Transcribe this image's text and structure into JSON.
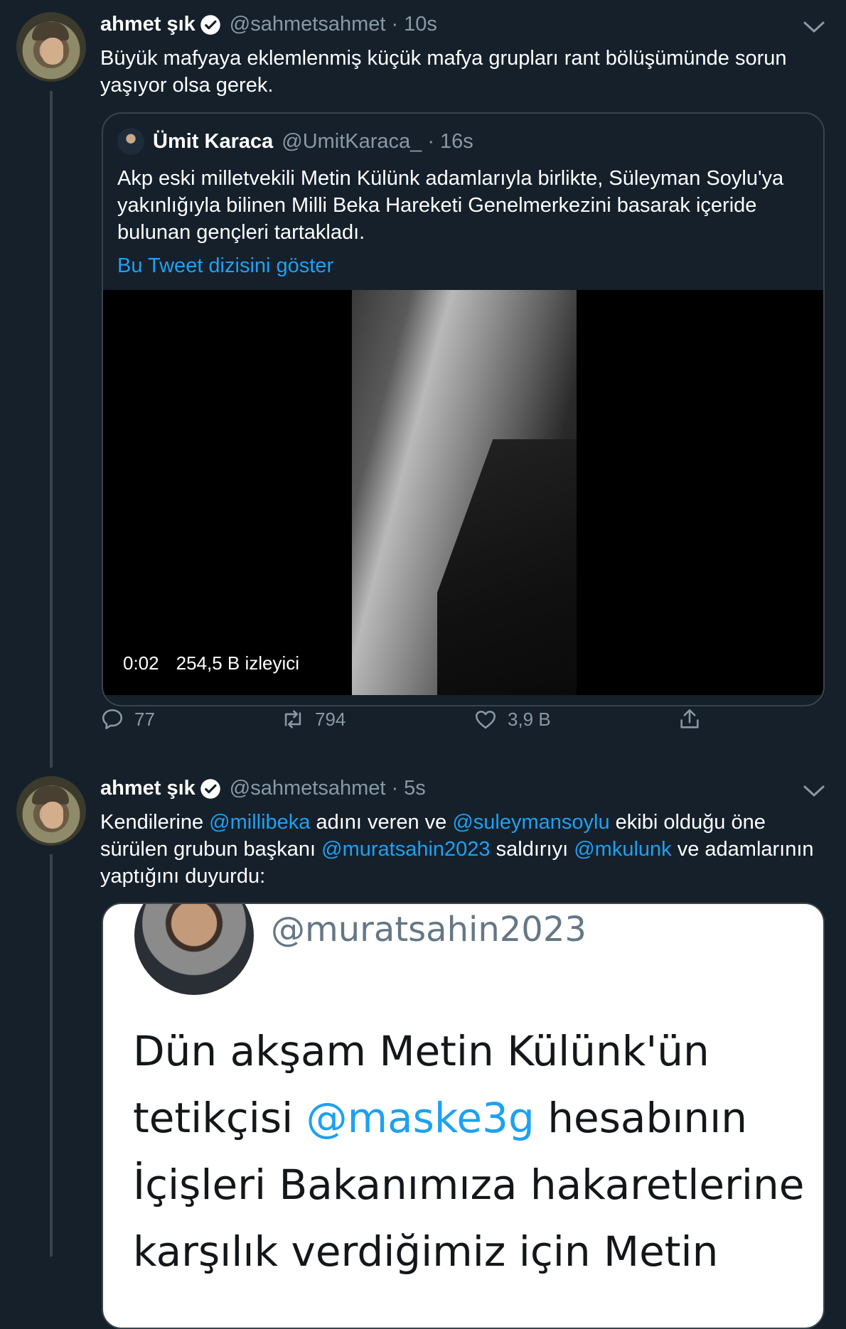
{
  "tweets": [
    {
      "author": "ahmet şık",
      "handle": "@sahmetsahmet",
      "separator": "·",
      "time": "10s",
      "text": "Büyük mafyaya eklemlenmiş küçük mafya grupları rant bölüşümünde sorun yaşıyor olsa gerek.",
      "quote": {
        "author": "Ümit Karaca",
        "handle": "@UmitKaraca_",
        "separator": "·",
        "time": "16s",
        "text": "Akp eski milletvekili Metin Külünk adamlarıyla birlikte, Süleyman Soylu'ya yakınlığıyla bilinen Milli Beka Hareketi Genelmerkezini basarak içeride bulunan gençleri tartakladı.",
        "show_thread": "Bu Tweet dizisini göster",
        "video": {
          "duration": "0:02",
          "views": "254,5 B izleyici"
        }
      },
      "actions": {
        "replies": "77",
        "retweets": "794",
        "likes": "3,9 B"
      }
    },
    {
      "author": "ahmet şık",
      "handle": "@sahmetsahmet",
      "separator": "·",
      "time": "5s",
      "text_parts": [
        "Kendilerine ",
        "@millibeka",
        " adını veren ve ",
        "@suleymansoylu",
        " ekibi olduğu öne sürülen grubun başkanı ",
        "@muratsahin2023",
        " saldırıyı ",
        "@mkulunk",
        " ve adamlarının yaptığını duyurdu:"
      ],
      "image": {
        "handle": "@muratsahin2023",
        "text_parts": [
          "Dün akşam Metin Külünk'ün tetikçisi ",
          "@maske3g",
          " hesabının İçişleri Bakanımıza hakaretlerine karşılık verdiğimiz için Metin"
        ]
      }
    }
  ],
  "icons": {
    "verified": "verified-badge-icon",
    "chevron": "chevron-down-icon",
    "reply": "reply-icon",
    "retweet": "retweet-icon",
    "like": "heart-icon",
    "share": "share-icon"
  },
  "colors": {
    "background": "#15202b",
    "accent": "#1da1f2",
    "muted": "#8899a6",
    "border": "#38444d"
  }
}
